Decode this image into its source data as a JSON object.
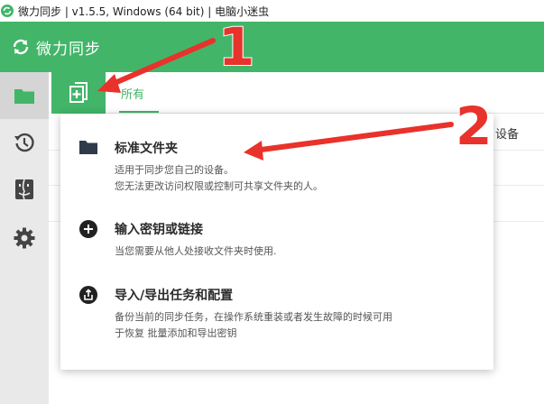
{
  "window": {
    "title": "微力同步 | v1.5.5, Windows (64 bit) | 电脑小迷虫"
  },
  "header": {
    "brand": "微力同步"
  },
  "sidebar": {
    "items": [
      {
        "icon": "folder-icon",
        "active": true
      },
      {
        "icon": "history-icon",
        "active": false
      },
      {
        "icon": "finder-icon",
        "active": false
      },
      {
        "icon": "gear-icon",
        "active": false
      }
    ]
  },
  "main": {
    "add_button_icon": "add-folder-icon",
    "tabs": [
      {
        "label": "所有",
        "active": true
      }
    ],
    "columns": {
      "device": "设备"
    }
  },
  "menu": {
    "items": [
      {
        "icon": "folder-icon",
        "title": "标准文件夹",
        "desc_lines": [
          "适用于同步您自己的设备。",
          "您无法更改访问权限或控制可共享文件夹的人。"
        ]
      },
      {
        "icon": "plus-circle-icon",
        "title": "输入密钥或链接",
        "desc_lines": [
          "当您需要从他人处接收文件夹时使用."
        ]
      },
      {
        "icon": "share-circle-icon",
        "title": "导入/导出任务和配置",
        "desc_lines": [
          "备份当前的同步任务，在操作系统重装或者发生故障的时候可用",
          "于恢复 批量添加和导出密钥"
        ]
      }
    ]
  },
  "annotations": {
    "arrow1_number": "1",
    "arrow2_number": "2",
    "color": "#e8322b"
  },
  "colors": {
    "brand": "#42b569",
    "annotation": "#e8322b"
  }
}
